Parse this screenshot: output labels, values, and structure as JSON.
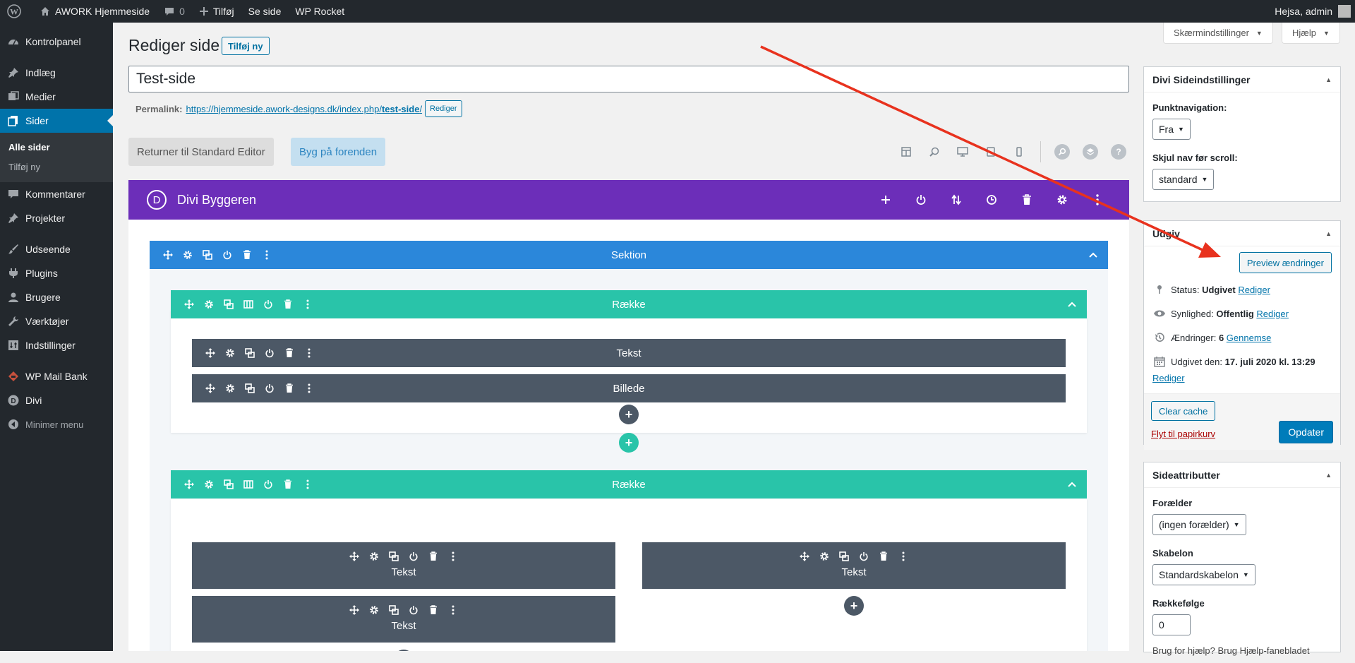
{
  "admin_bar": {
    "site_name": "AWORK Hjemmeside",
    "comments_count": "0",
    "new_label": "Tilføj",
    "view_label": "Se side",
    "rocket_label": "WP Rocket",
    "greeting": "Hejsa, admin"
  },
  "sidebar": {
    "items": [
      {
        "label": "Kontrolpanel",
        "icon": "dashboard-icon"
      },
      {
        "label": "Indlæg",
        "icon": "pin-icon"
      },
      {
        "label": "Medier",
        "icon": "media-icon"
      },
      {
        "label": "Sider",
        "icon": "pages-icon"
      },
      {
        "label": "Kommentarer",
        "icon": "comment-icon"
      },
      {
        "label": "Projekter",
        "icon": "pin-icon"
      },
      {
        "label": "Udseende",
        "icon": "brush-icon"
      },
      {
        "label": "Plugins",
        "icon": "plugin-icon"
      },
      {
        "label": "Brugere",
        "icon": "user-icon"
      },
      {
        "label": "Værktøjer",
        "icon": "wrench-icon"
      },
      {
        "label": "Indstillinger",
        "icon": "settings-icon"
      },
      {
        "label": "WP Mail Bank",
        "icon": "mail-bank-icon"
      },
      {
        "label": "Divi",
        "icon": "divi-icon"
      },
      {
        "label": "Minimer menu",
        "icon": "collapse-icon"
      }
    ],
    "submenu": [
      "Alle sider",
      "Tilføj ny"
    ]
  },
  "header": {
    "title": "Rediger side",
    "add_new": "Tilføj ny",
    "screen_options": "Skærmindstillinger",
    "help": "Hjælp"
  },
  "editor": {
    "page_title": "Test-side",
    "permalink_label": "Permalink:",
    "permalink_base": "https://hjemmeside.awork-designs.dk/index.php/",
    "permalink_slug": "test-side",
    "permalink_end": "/",
    "permalink_edit": "Rediger",
    "return_button": "Returner til Standard Editor",
    "build_button": "Byg på forenden"
  },
  "divi": {
    "logo": "D",
    "title": "Divi Byggeren",
    "section_label": "Sektion",
    "row_label": "Række",
    "module_text": "Tekst",
    "module_image": "Billede"
  },
  "divi_settings": {
    "title": "Divi Sideindstillinger",
    "dot_nav_label": "Punktnavigation:",
    "dot_nav_value": "Fra",
    "hide_nav_label": "Skjul nav før scroll:",
    "hide_nav_value": "standard"
  },
  "publish": {
    "title": "Udgiv",
    "preview": "Preview ændringer",
    "status_label": "Status:",
    "status_value": "Udgivet",
    "visibility_label": "Synlighed:",
    "visibility_value": "Offentlig",
    "revisions_label": "Ændringer:",
    "revisions_value": "6",
    "revisions_link": "Gennemse",
    "published_label": "Udgivet den:",
    "published_value": "17. juli 2020 kl. 13:29",
    "edit_link": "Rediger",
    "clear_cache": "Clear cache",
    "trash": "Flyt til papirkurv",
    "update": "Opdater"
  },
  "attributes": {
    "title": "Sideattributter",
    "parent_label": "Forælder",
    "parent_value": "(ingen forælder)",
    "template_label": "Skabelon",
    "template_value": "Standardskabelon",
    "order_label": "Rækkefølge",
    "order_value": "0",
    "help_text": "Brug for hjælp? Brug Hjælp-fanebladet"
  },
  "colors": {
    "divi_purple": "#6c2eb9",
    "section_blue": "#2b87da",
    "row_teal": "#29c4a9",
    "module_dark": "#4c5866",
    "wp_blue": "#0073aa",
    "annotation_arrow": "#e8321e"
  }
}
